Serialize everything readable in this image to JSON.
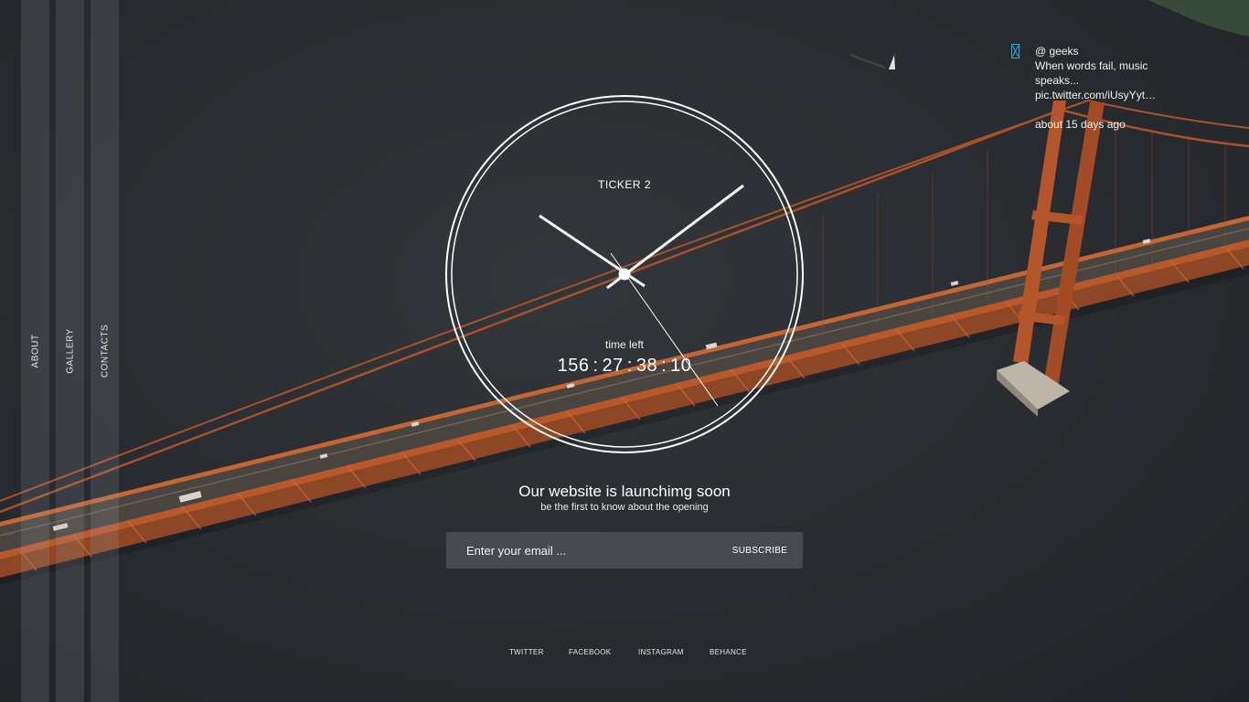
{
  "nav": {
    "items": [
      {
        "label": "ABOUT"
      },
      {
        "label": "GALLERY"
      },
      {
        "label": "CONTACTS"
      }
    ]
  },
  "clock": {
    "title": "TICKER 2",
    "time_left_label": "time left",
    "countdown": {
      "days": "156",
      "hours": "27",
      "minutes": "38",
      "seconds": "10"
    }
  },
  "launch": {
    "headline": "Our website is launchimg soon",
    "subline": "be the first to know about the opening"
  },
  "subscribe": {
    "placeholder": "Enter your email ...",
    "button_label": "SUBSCRIBE"
  },
  "social": {
    "links": [
      {
        "label": "TWITTER"
      },
      {
        "label": "FACEBOOK"
      },
      {
        "label": "INSTAGRAM"
      },
      {
        "label": "BEHANCE"
      }
    ]
  },
  "tweet": {
    "handle": "@ geeks",
    "text": "When words fail, music speaks... pic.twitter.com/iUsyYyt…",
    "time": "about 15 days ago",
    "icon": "hourglass-icon"
  },
  "colors": {
    "background": "#2a2d31",
    "bridge": "#b8592c",
    "accent_icon": "#3fa7c4"
  }
}
